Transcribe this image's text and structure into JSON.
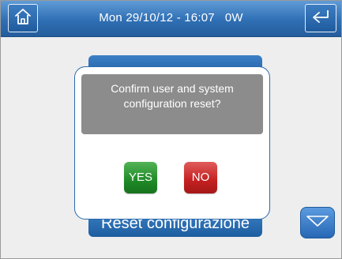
{
  "header": {
    "status_text": "Mon 29/10/12 - 16:07   0W",
    "home_icon": "home-icon",
    "back_icon": "return-arrow-icon"
  },
  "background": {
    "button_label": "Reset configurazione",
    "scroll_icon": "chevron-down-icon"
  },
  "dialog": {
    "message_line1": "Confirm user and system",
    "message_line2": "configuration reset?",
    "yes_label": "YES",
    "no_label": "NO"
  },
  "colors": {
    "header_blue": "#2f6fb4",
    "yes_green": "#1f8a27",
    "no_red": "#c42020",
    "message_grey": "#8c8c8c"
  }
}
